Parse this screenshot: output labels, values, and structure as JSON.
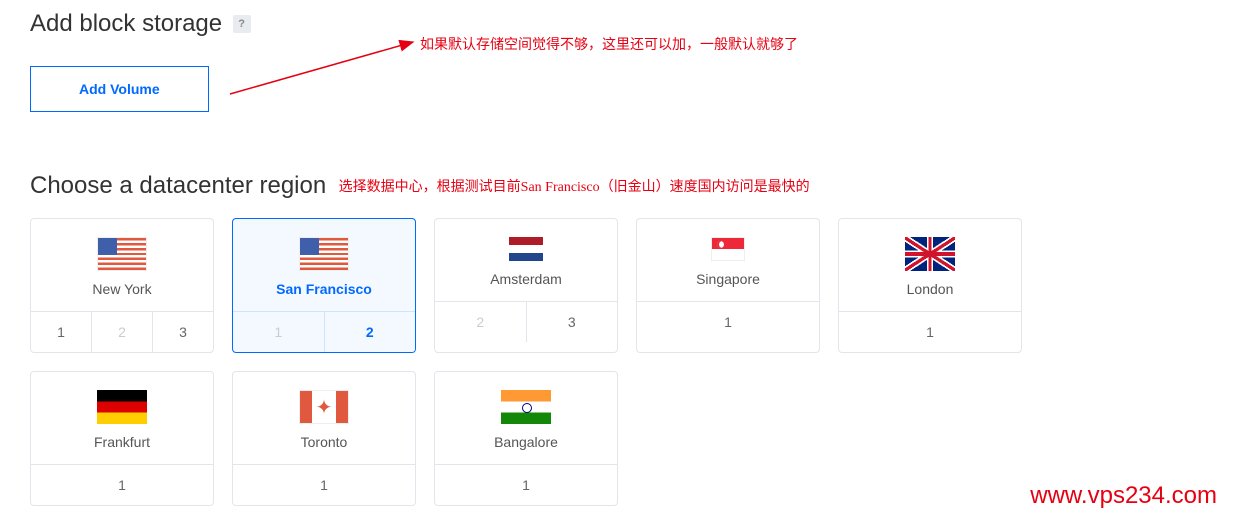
{
  "block_storage": {
    "title": "Add block storage",
    "help_glyph": "?",
    "add_volume_label": "Add Volume",
    "annotation": "如果默认存储空间觉得不够，这里还可以加，一般默认就够了"
  },
  "datacenter": {
    "title": "Choose a datacenter region",
    "annotation": "选择数据中心，根据测试目前San Francisco（旧金山）速度国内访问是最快的",
    "regions": [
      {
        "name": "New York",
        "flag": "flag-us",
        "selected": false,
        "numbers": [
          {
            "label": "1",
            "state": "enabled"
          },
          {
            "label": "2",
            "state": "disabled"
          },
          {
            "label": "3",
            "state": "enabled"
          }
        ]
      },
      {
        "name": "San Francisco",
        "flag": "flag-us",
        "selected": true,
        "numbers": [
          {
            "label": "1",
            "state": "disabled"
          },
          {
            "label": "2",
            "state": "active"
          }
        ]
      },
      {
        "name": "Amsterdam",
        "flag": "flag-nl",
        "selected": false,
        "numbers": [
          {
            "label": "2",
            "state": "disabled"
          },
          {
            "label": "3",
            "state": "enabled"
          }
        ]
      },
      {
        "name": "Singapore",
        "flag": "flag-sg",
        "selected": false,
        "numbers": [
          {
            "label": "1",
            "state": "enabled"
          }
        ]
      },
      {
        "name": "London",
        "flag": "flag-uk",
        "selected": false,
        "numbers": [
          {
            "label": "1",
            "state": "enabled"
          }
        ]
      },
      {
        "name": "Frankfurt",
        "flag": "flag-de",
        "selected": false,
        "numbers": [
          {
            "label": "1",
            "state": "enabled"
          }
        ]
      },
      {
        "name": "Toronto",
        "flag": "flag-ca",
        "selected": false,
        "numbers": [
          {
            "label": "1",
            "state": "enabled"
          }
        ]
      },
      {
        "name": "Bangalore",
        "flag": "flag-in",
        "selected": false,
        "numbers": [
          {
            "label": "1",
            "state": "enabled"
          }
        ]
      }
    ]
  },
  "watermark": "www.vps234.com"
}
